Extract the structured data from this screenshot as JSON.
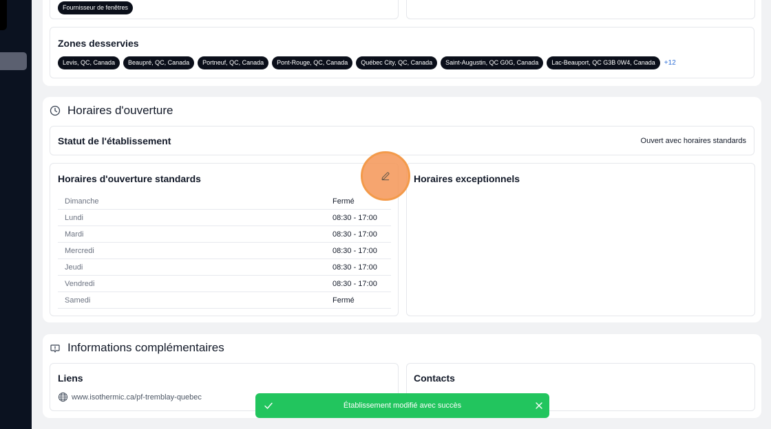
{
  "top_card": {
    "supplier_tag": "Fournisseur de fenêtres",
    "zones_title": "Zones desservies",
    "zones": [
      "Levis, QC, Canada",
      "Beaupré, QC, Canada",
      "Portneuf, QC, Canada",
      "Pont-Rouge, QC, Canada",
      "Québec City, QC, Canada",
      "Saint-Augustin, QC G0G, Canada",
      "Lac-Beauport, QC G3B 0W4, Canada"
    ],
    "zones_more": "+12"
  },
  "hours_section": {
    "title": "Horaires d'ouverture",
    "status_label": "Statut de l'établissement",
    "status_value": "Ouvert avec horaires standards",
    "standard_title": "Horaires d'ouverture standards",
    "exceptional_title": "Horaires exceptionnels",
    "days": [
      {
        "day": "Dimanche",
        "hours": "Fermé"
      },
      {
        "day": "Lundi",
        "hours": "08:30 - 17:00"
      },
      {
        "day": "Mardi",
        "hours": "08:30 - 17:00"
      },
      {
        "day": "Mercredi",
        "hours": "08:30 - 17:00"
      },
      {
        "day": "Jeudi",
        "hours": "08:30 - 17:00"
      },
      {
        "day": "Vendredi",
        "hours": "08:30 - 17:00"
      },
      {
        "day": "Samedi",
        "hours": "Fermé"
      }
    ]
  },
  "info_section": {
    "title": "Informations complémentaires",
    "links_title": "Liens",
    "link_url": "www.isothermic.ca/pf-tremblay-quebec",
    "contacts_title": "Contacts"
  },
  "toast": {
    "message": "Établissement modifié avec succès"
  },
  "icons": {
    "clock": "clock-icon",
    "info": "info-message-icon",
    "edit": "pencil-icon",
    "globe": "globe-icon",
    "check": "check-icon",
    "close": "close-icon"
  },
  "colors": {
    "sidebar": "#0b1220",
    "pill": "#0b0f1a",
    "toast": "#22c55e",
    "highlight": "#f39a4a",
    "link_more": "#2f6fd6"
  }
}
